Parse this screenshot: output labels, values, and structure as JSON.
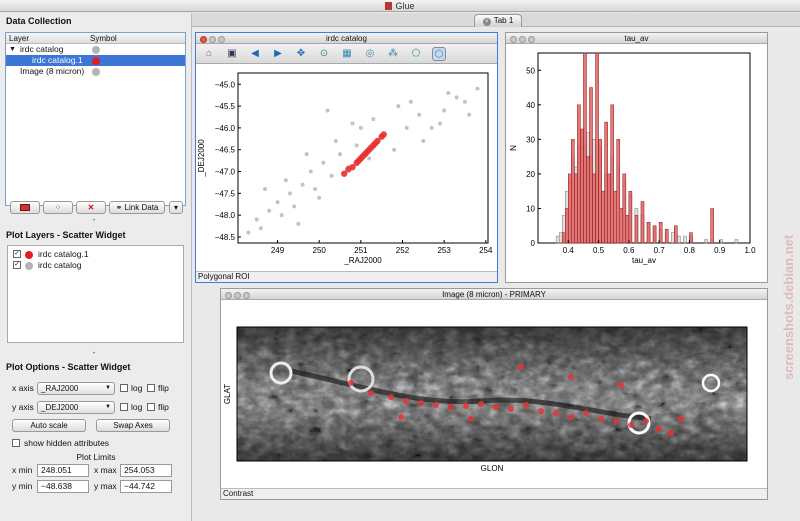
{
  "app": {
    "title": "Glue",
    "tab": "Tab 1"
  },
  "data_collection": {
    "title": "Data Collection",
    "columns": [
      "Layer",
      "Symbol"
    ],
    "rows": [
      {
        "label": "irdc catalog",
        "color": "#b4b4b4"
      },
      {
        "label": "irdc catalog.1",
        "color": "#e02020"
      },
      {
        "label": "Image (8 micron)",
        "color": "#b4b4b4"
      }
    ],
    "buttons": {
      "link": "Link Data"
    }
  },
  "plot_layers": {
    "title": "Plot Layers - Scatter Widget",
    "rows": [
      {
        "label": "irdc catalog.1",
        "color": "#e02020"
      },
      {
        "label": "irdc catalog",
        "color": "#b4b4b4"
      }
    ]
  },
  "plot_options": {
    "title": "Plot Options - Scatter Widget",
    "x_axis_label": "x axis",
    "x_axis_value": "_RAJ2000",
    "y_axis_label": "y axis",
    "y_axis_value": "_DEJ2000",
    "log_label": "log",
    "flip_label": "flip",
    "auto_scale": "Auto scale",
    "swap_axes": "Swap Axes",
    "show_hidden": "show hidden attributes",
    "limits_title": "Plot Limits",
    "xmin_label": "x min",
    "xmin": "248.051",
    "xmax_label": "x max",
    "xmax": "254.053",
    "ymin_label": "y min",
    "ymin": "−48.638",
    "ymax_label": "y max",
    "ymax": "−44.742"
  },
  "scatter_window": {
    "title": "irdc catalog",
    "status": "Polygonal ROI",
    "colors": {
      "grey": "#b8b8b8",
      "red": "#e83030"
    },
    "chart_data": {
      "type": "scatter",
      "xlabel": "_RAJ2000",
      "ylabel": "_DEJ2000",
      "xlim": [
        248.051,
        254.053
      ],
      "ylim": [
        -48.638,
        -44.742
      ],
      "xticks": [
        "249",
        "250",
        "251",
        "252",
        "253",
        "254"
      ],
      "yticks": [
        "−45.0",
        "−45.5",
        "−46.0",
        "−46.5",
        "−47.0",
        "−47.5",
        "−48.0",
        "−48.5"
      ],
      "series": [
        {
          "color": "#b8b8b8",
          "x": [
            248.3,
            248.5,
            248.6,
            248.8,
            249.0,
            249.1,
            249.3,
            249.4,
            249.6,
            249.8,
            249.9,
            250.1,
            250.3,
            250.5,
            250.7,
            250.9,
            251.2,
            251.5,
            251.8,
            252.1,
            252.4,
            252.7,
            253.0,
            253.3,
            253.5,
            253.8,
            249.2,
            249.5,
            250.0,
            250.4,
            250.8,
            251.3,
            251.9,
            252.5,
            253.1,
            248.7,
            249.7,
            250.2,
            251.0,
            252.2,
            252.9,
            253.6
          ],
          "y": [
            -48.4,
            -48.1,
            -48.3,
            -47.9,
            -47.7,
            -48.0,
            -47.5,
            -47.8,
            -47.3,
            -47.0,
            -47.4,
            -46.8,
            -47.1,
            -46.6,
            -46.9,
            -46.4,
            -46.7,
            -46.2,
            -46.5,
            -46.0,
            -45.7,
            -46.0,
            -45.6,
            -45.3,
            -45.4,
            -45.1,
            -47.2,
            -48.2,
            -47.6,
            -46.3,
            -45.9,
            -45.8,
            -45.5,
            -46.3,
            -45.2,
            -47.4,
            -46.6,
            -45.6,
            -46.0,
            -45.4,
            -45.9,
            -45.7
          ]
        },
        {
          "color": "#e83030",
          "x": [
            250.6,
            250.7,
            250.8,
            250.9,
            250.95,
            251.0,
            251.05,
            251.1,
            251.15,
            251.2,
            251.25,
            251.3,
            251.35,
            251.4,
            251.5,
            251.55
          ],
          "y": [
            -47.05,
            -46.95,
            -46.9,
            -46.8,
            -46.75,
            -46.7,
            -46.65,
            -46.6,
            -46.55,
            -46.5,
            -46.45,
            -46.4,
            -46.35,
            -46.3,
            -46.2,
            -46.15
          ]
        }
      ]
    }
  },
  "histogram_window": {
    "title": "tau_av",
    "chart_data": {
      "type": "bar",
      "xlabel": "tau_av",
      "ylabel": "N",
      "xlim": [
        0.3,
        1.0
      ],
      "ylim": [
        0,
        55
      ],
      "xticks": [
        "0.4",
        "0.5",
        "0.6",
        "0.7",
        "0.8",
        "0.9",
        "1.0"
      ],
      "yticks": [
        "0",
        "10",
        "20",
        "30",
        "40",
        "50"
      ],
      "bin_width": 0.01,
      "series": [
        {
          "name": "",
          "color": "#e06060",
          "x": [
            0.38,
            0.39,
            0.4,
            0.41,
            0.42,
            0.43,
            0.44,
            0.45,
            0.46,
            0.47,
            0.48,
            0.49,
            0.5,
            0.51,
            0.52,
            0.53,
            0.54,
            0.55,
            0.56,
            0.57,
            0.58,
            0.59,
            0.6,
            0.62,
            0.64,
            0.66,
            0.68,
            0.7,
            0.72,
            0.75,
            0.8,
            0.87
          ],
          "values": [
            3,
            10,
            20,
            30,
            20,
            40,
            33,
            55,
            25,
            45,
            20,
            55,
            30,
            15,
            35,
            20,
            40,
            15,
            30,
            10,
            20,
            8,
            15,
            8,
            12,
            6,
            5,
            6,
            4,
            5,
            3,
            10
          ]
        },
        {
          "name": "",
          "color": "#aaaaaa",
          "x": [
            0.36,
            0.37,
            0.38,
            0.39,
            0.4,
            0.41,
            0.42,
            0.43,
            0.44,
            0.45,
            0.46,
            0.47,
            0.48,
            0.49,
            0.5,
            0.52,
            0.54,
            0.56,
            0.58,
            0.6,
            0.62,
            0.64,
            0.66,
            0.68,
            0.7,
            0.72,
            0.74,
            0.76,
            0.78,
            0.8,
            0.85,
            0.9,
            0.95
          ],
          "values": [
            2,
            3,
            8,
            15,
            18,
            25,
            22,
            28,
            30,
            28,
            32,
            25,
            30,
            20,
            28,
            20,
            25,
            22,
            18,
            14,
            10,
            8,
            6,
            5,
            4,
            3,
            3,
            2,
            2,
            2,
            1,
            1,
            1
          ]
        }
      ]
    }
  },
  "image_window": {
    "title": "Image (8 micron) - PRIMARY",
    "xlabel": "GLON",
    "ylabel": "GLAT",
    "status": "Contrast"
  },
  "watermark": "screenshots.debian.net"
}
